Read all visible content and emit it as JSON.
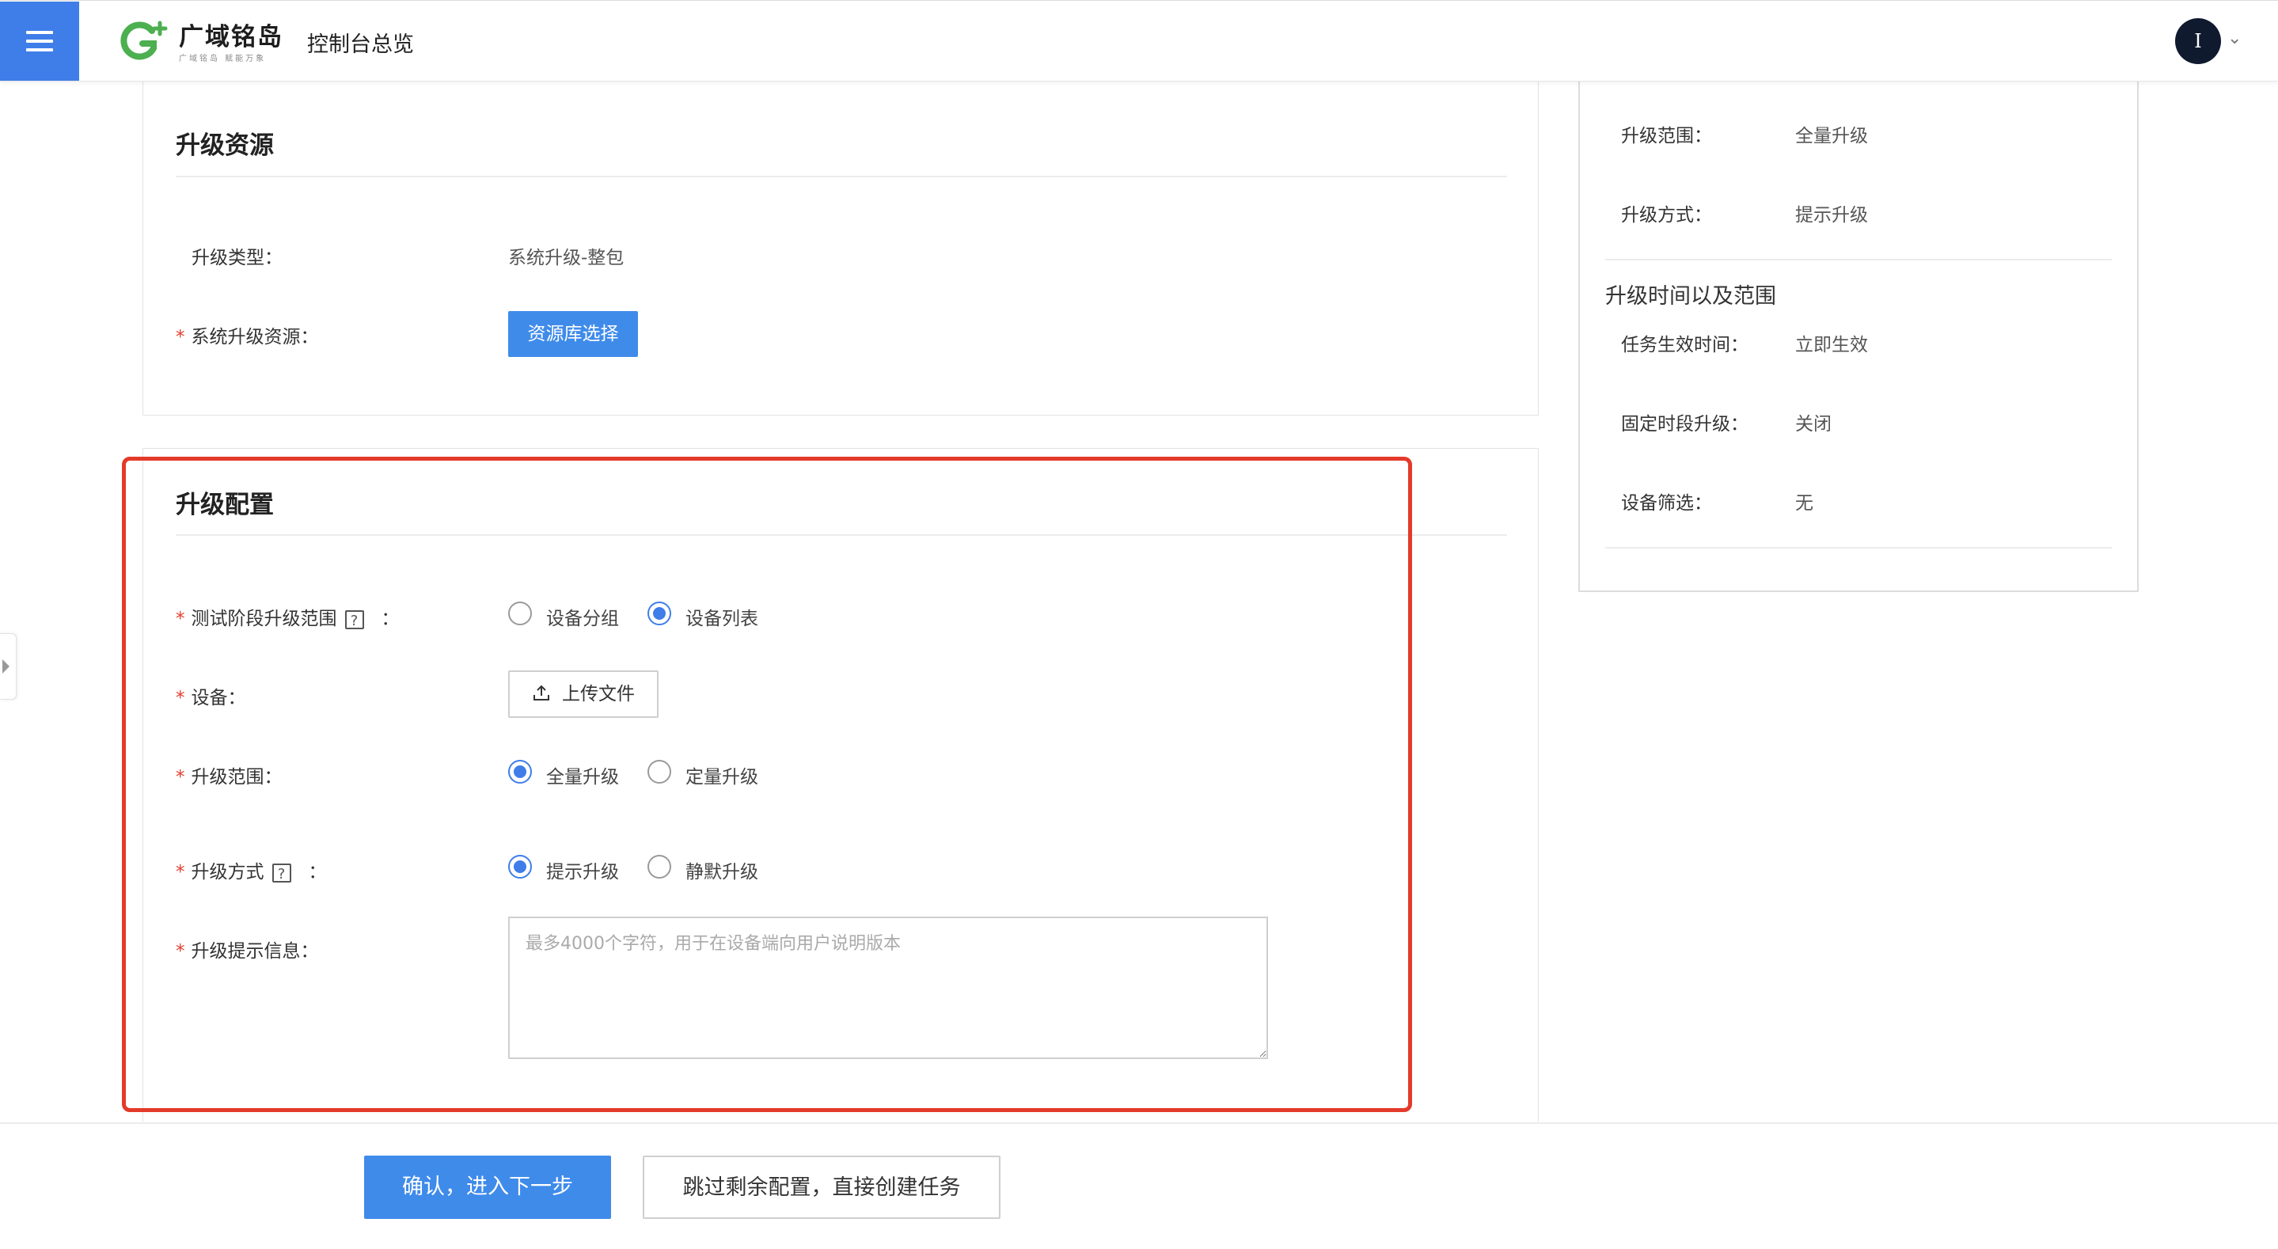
{
  "header": {
    "brand": "广域铭岛",
    "brand_tagline": "广域铭岛 赋能万象",
    "console_title": "控制台总览",
    "avatar_initial": "I"
  },
  "resource_section": {
    "title": "升级资源",
    "upgrade_type_label": "升级类型：",
    "upgrade_type_value": "系统升级-整包",
    "resource_label": "系统升级资源：",
    "resource_button": "资源库选择"
  },
  "config_section": {
    "title": "升级配置",
    "test_scope_label": "测试阶段升级范围",
    "test_scope_options": [
      "设备分组",
      "设备列表"
    ],
    "test_scope_selected": "设备列表",
    "device_label": "设备：",
    "upload_button": "上传文件",
    "scope_label": "升级范围：",
    "scope_options": [
      "全量升级",
      "定量升级"
    ],
    "scope_selected": "全量升级",
    "method_label": "升级方式",
    "method_options": [
      "提示升级",
      "静默升级"
    ],
    "method_selected": "提示升级",
    "message_label": "升级提示信息：",
    "message_placeholder": "最多4000个字符，用于在设备端向用户说明版本",
    "help_glyph": "?",
    "colon": "："
  },
  "summary": {
    "scope_label": "升级范围：",
    "scope_value": "全量升级",
    "method_label": "升级方式：",
    "method_value": "提示升级",
    "time_section_title": "升级时间以及范围",
    "effective_time_label": "任务生效时间：",
    "effective_time_value": "立即生效",
    "fixed_period_label": "固定时段升级：",
    "fixed_period_value": "关闭",
    "device_filter_label": "设备筛选：",
    "device_filter_value": "无"
  },
  "footer": {
    "confirm_button": "确认，进入下一步",
    "skip_button": "跳过剩余配置，直接创建任务"
  },
  "colors": {
    "primary": "#3f7ee8",
    "button_blue": "#3f8bea",
    "required_star": "#e0402f",
    "highlight_border": "#e33a2a",
    "logo_green": "#4caf50"
  }
}
